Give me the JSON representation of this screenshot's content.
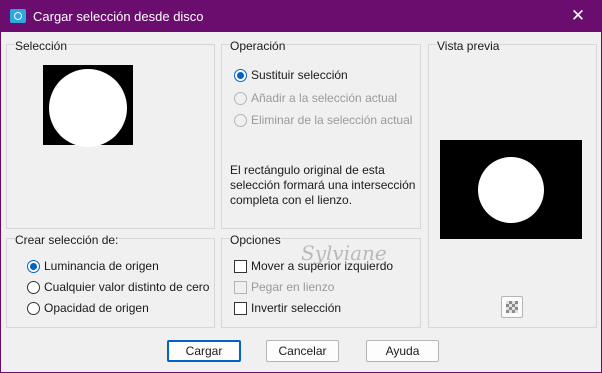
{
  "window": {
    "title": "Cargar selección desde disco",
    "close_glyph": "✕"
  },
  "seleccion": {
    "label": "Selección"
  },
  "operacion": {
    "label": "Operación",
    "options": [
      {
        "label": "Sustituir selección",
        "checked": true,
        "enabled": true
      },
      {
        "label": "Añadir a la selección actual",
        "checked": false,
        "enabled": false
      },
      {
        "label": "Eliminar de la selección actual",
        "checked": false,
        "enabled": false
      }
    ],
    "info": [
      "El rectángulo original de esta",
      "selección formará una intersección",
      "completa con el lienzo."
    ]
  },
  "vista_previa": {
    "label": "Vista previa",
    "transparency_icon": "checkerboard-icon"
  },
  "crear": {
    "label": "Crear selección de:",
    "options": [
      {
        "label": "Luminancia de origen",
        "checked": true
      },
      {
        "label": "Cualquier valor distinto de cero",
        "checked": false
      },
      {
        "label": "Opacidad de origen",
        "checked": false
      }
    ]
  },
  "opciones": {
    "label": "Opciones",
    "items": [
      {
        "label": "Mover a superior izquierdo",
        "checked": false,
        "enabled": true
      },
      {
        "label": "Pegar en lienzo",
        "checked": false,
        "enabled": false
      },
      {
        "label": "Invertir selección",
        "checked": false,
        "enabled": true
      }
    ]
  },
  "buttons": {
    "load": "Cargar",
    "cancel": "Cancelar",
    "help": "Ayuda"
  },
  "watermark": "Sylviane",
  "colors": {
    "titlebar": "#6a0d6e",
    "accent": "#0063c6"
  }
}
